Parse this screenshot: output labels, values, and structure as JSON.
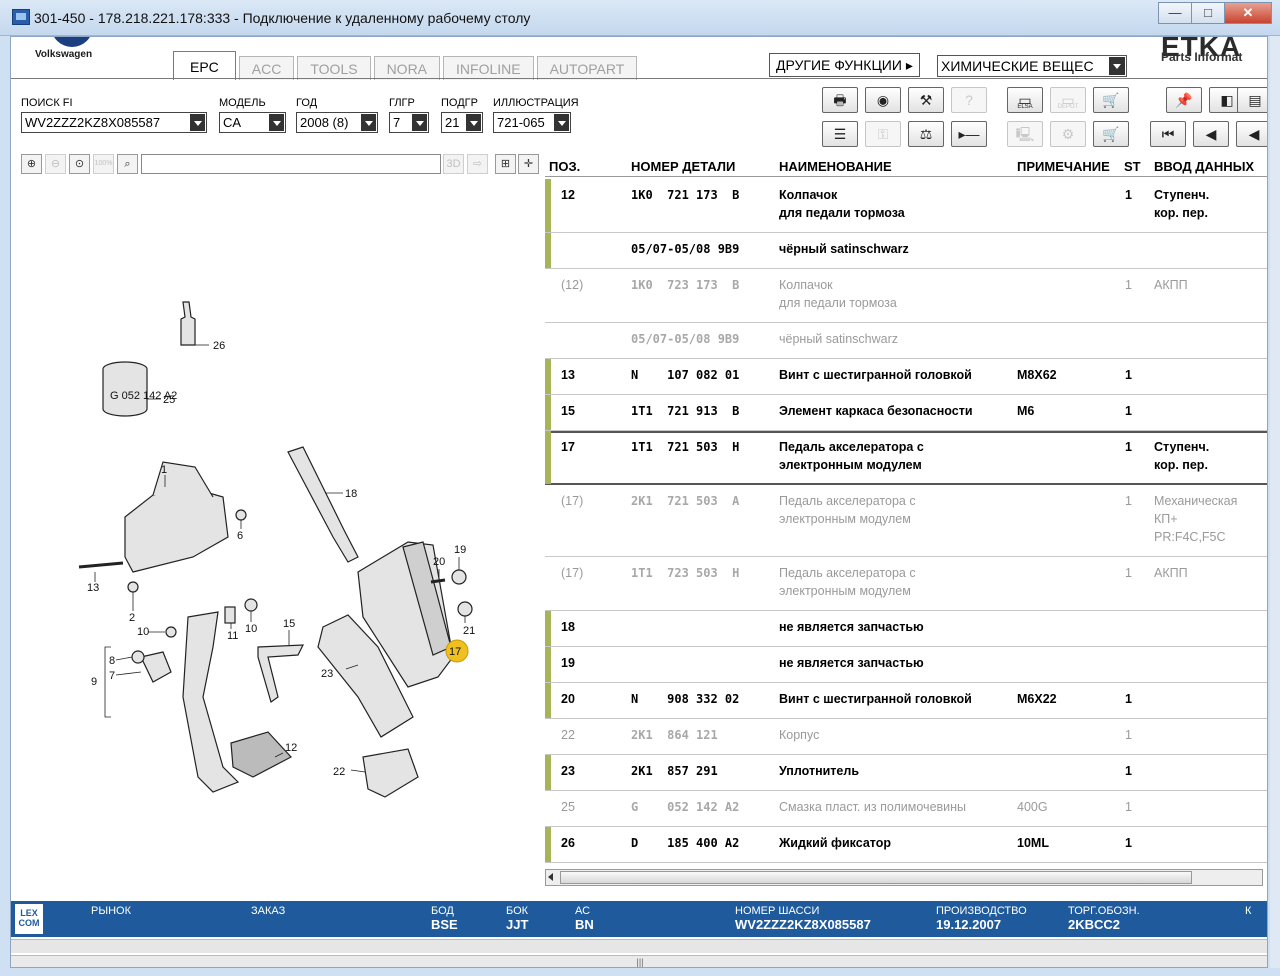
{
  "window": {
    "title": "301-450 - 178.218.221.178:333 - Подключение к удаленному рабочему столу",
    "minimize": "—",
    "maximize": "□",
    "close": "✕"
  },
  "header": {
    "brand": "Volkswagen",
    "tabs": [
      "EPC",
      "ACC",
      "TOOLS",
      "NORA",
      "INFOLINE",
      "AUTOPART"
    ],
    "other_functions": "ДРУГИЕ ФУНКЦИИ ▸",
    "chemicals": "ХИМИЧЕСКИЕ ВЕЩЕС",
    "etka_logo": "ETKA",
    "etka_sub": "Parts Informat"
  },
  "filters": {
    "search_fi": {
      "label": "ПОИСК FI",
      "value": "WV2ZZZ2KZ8X085587"
    },
    "model": {
      "label": "МОДЕЛЬ",
      "value": "CA"
    },
    "year": {
      "label": "ГОД",
      "value": "2008 (8)"
    },
    "main_group": {
      "label": "ГЛГР",
      "value": "7"
    },
    "sub_group": {
      "label": "ПОДГР",
      "value": "21"
    },
    "illustration": {
      "label": "ИЛЛЮСТРАЦИЯ",
      "value": "721-065"
    }
  },
  "toolbar": {
    "elsa": "ELSA",
    "depot": "DEPOT"
  },
  "ill_toolbar": {
    "zoom_pct": "100%",
    "view3d": "3D"
  },
  "table": {
    "headers": {
      "pos": "ПОЗ.",
      "part": "НОМЕР ДЕТАЛИ",
      "name": "НАИМЕНОВАНИЕ",
      "note": "ПРИМЕЧАНИЕ",
      "st": "ST",
      "input": "ВВОД ДАННЫХ"
    },
    "rows": [
      {
        "pos": "12",
        "part": "1K0  721 173  B",
        "name": "Колпачок\nдля педали тормоза",
        "note": "",
        "st": "1",
        "input": "Ступенч.\nкор. пер."
      },
      {
        "pos": "",
        "part": "05/07-05/08 9B9",
        "name": "чёрный satinschwarz",
        "note": "",
        "st": "",
        "input": ""
      },
      {
        "pos": "(12)",
        "part": "1K0  723 173  B",
        "name": "Колпачок\nдля педали тормоза",
        "note": "",
        "st": "1",
        "input": "АКПП"
      },
      {
        "pos": "",
        "part": "05/07-05/08 9B9",
        "name": "чёрный satinschwarz",
        "note": "",
        "st": "",
        "input": ""
      },
      {
        "pos": "13",
        "part": "N    107 082 01",
        "name": "Винт с шестигранной головкой",
        "note": "M8X62",
        "st": "1",
        "input": ""
      },
      {
        "pos": "15",
        "part": "1T1  721 913  B",
        "name": "Элемент каркаса безопасности",
        "note": "M6",
        "st": "1",
        "input": ""
      },
      {
        "pos": "17",
        "part": "1T1  721 503  H",
        "name": "Педаль акселератора с\nэлектронным модулем",
        "note": "",
        "st": "1",
        "input": "Ступенч.\nкор. пер."
      },
      {
        "pos": "(17)",
        "part": "2K1  721 503  A",
        "name": "Педаль акселератора с\nэлектронным модулем",
        "note": "",
        "st": "1",
        "input": "Механическая\nКП+\nPR:F4C,F5C"
      },
      {
        "pos": "(17)",
        "part": "1T1  723 503  H",
        "name": "Педаль акселератора с\nэлектронным модулем",
        "note": "",
        "st": "1",
        "input": "АКПП"
      },
      {
        "pos": "18",
        "part": "",
        "name": "не является запчастью",
        "note": "",
        "st": "",
        "input": ""
      },
      {
        "pos": "19",
        "part": "",
        "name": "не является запчастью",
        "note": "",
        "st": "",
        "input": ""
      },
      {
        "pos": "20",
        "part": "N    908 332 02",
        "name": "Винт с шестигранной головкой",
        "note": "M6X22",
        "st": "1",
        "input": ""
      },
      {
        "pos": "22",
        "part": "2K1  864 121",
        "name": "Корпус",
        "note": "",
        "st": "1",
        "input": ""
      },
      {
        "pos": "23",
        "part": "2K1  857 291",
        "name": "Уплотнитель",
        "note": "",
        "st": "1",
        "input": ""
      },
      {
        "pos": "25",
        "part": "G    052 142 A2",
        "name": "Смазка пласт. из полимочевины",
        "note": "400G",
        "st": "1",
        "input": ""
      },
      {
        "pos": "26",
        "part": "D    185 400 A2",
        "name": "Жидкий фиксатор",
        "note": "10ML",
        "st": "1",
        "input": ""
      }
    ]
  },
  "illustration_labels": [
    "1",
    "2",
    "6",
    "7",
    "8",
    "9",
    "10",
    "11",
    "12",
    "13",
    "15",
    "17",
    "18",
    "19",
    "20",
    "21",
    "22",
    "23",
    "25",
    "26"
  ],
  "illustration_text": {
    "can_label": "G 052 142 A2"
  },
  "status": {
    "logo": "LEX\nCOM",
    "market": {
      "label": "РЫНОК",
      "value": ""
    },
    "order": {
      "label": "ЗАКАЗ",
      "value": ""
    },
    "bod": {
      "label": "БОД",
      "value": "BSE"
    },
    "bok": {
      "label": "БОК",
      "value": "JJT"
    },
    "ac": {
      "label": "АС",
      "value": "BN"
    },
    "chassis": {
      "label": "НОМЕР ШАССИ",
      "value": "WV2ZZZ2KZ8X085587"
    },
    "production": {
      "label": "ПРОИЗВОДСТВО",
      "value": "19.12.2007"
    },
    "trade": {
      "label": "ТОРГ.ОБОЗН.",
      "value": "2KBCC2"
    },
    "extra": {
      "label": "К",
      "value": ""
    }
  }
}
